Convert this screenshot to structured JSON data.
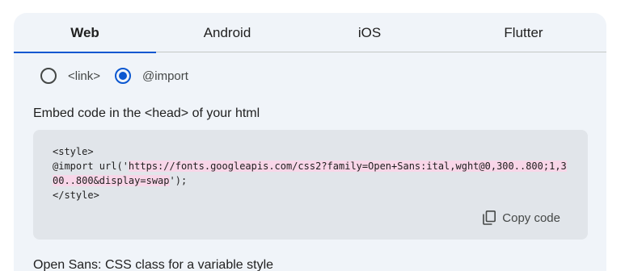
{
  "tabs": [
    {
      "label": "Web",
      "active": true
    },
    {
      "label": "Android",
      "active": false
    },
    {
      "label": "iOS",
      "active": false
    },
    {
      "label": "Flutter",
      "active": false
    }
  ],
  "embed_options": {
    "options": [
      {
        "label": "<link>",
        "selected": false
      },
      {
        "label": "@import",
        "selected": true
      }
    ]
  },
  "section": {
    "heading": "Embed code in the <head> of your html"
  },
  "code": {
    "line1": "<style>",
    "prefix": "@import url('",
    "url": "https://fonts.googleapis.com/css2?family=Open+Sans:ital,wght@0,300..800;1,300..800&display=swap",
    "suffix": "');",
    "line3": "</style>"
  },
  "copy_button": {
    "label": "Copy code",
    "icon": "copy-icon"
  },
  "next_section_text": "Open Sans: CSS class for a variable style",
  "colors": {
    "accent": "#0b57d0",
    "panel_bg": "#f0f4f9",
    "code_bg": "#e1e5ea",
    "highlight": "#f8d6e8"
  }
}
